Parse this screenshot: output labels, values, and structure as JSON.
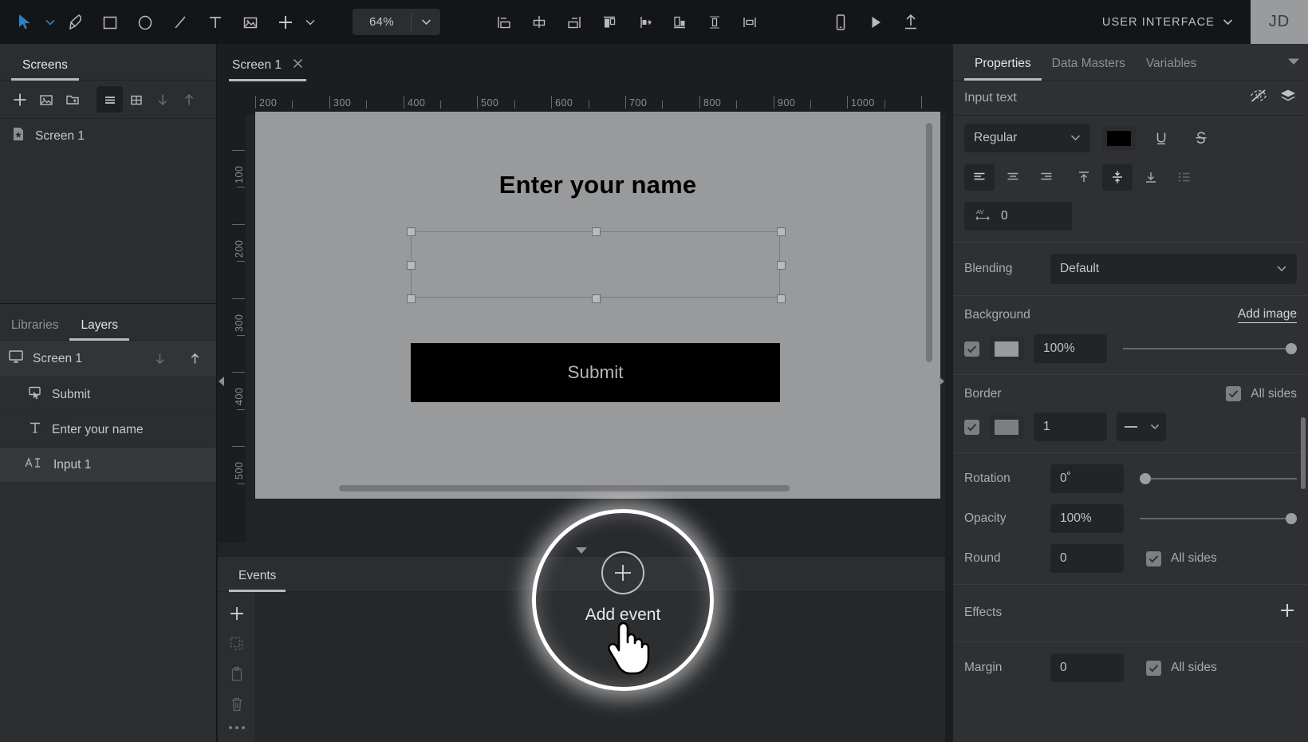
{
  "toolbar": {
    "tools": [
      {
        "name": "select-tool",
        "icon": "cursor-arrow-icon"
      },
      {
        "name": "pen-tool",
        "icon": "pen-icon"
      },
      {
        "name": "rectangle-tool",
        "icon": "rectangle-icon"
      },
      {
        "name": "ellipse-tool",
        "icon": "ellipse-icon"
      },
      {
        "name": "line-tool",
        "icon": "line-icon"
      },
      {
        "name": "text-tool",
        "icon": "text-t-icon"
      },
      {
        "name": "image-tool",
        "icon": "image-icon"
      },
      {
        "name": "add-tool",
        "icon": "plus-icon"
      }
    ],
    "zoom_value": "64%",
    "align_tools": [
      {
        "name": "align-left",
        "icon": "align-left-icon"
      },
      {
        "name": "align-center-horizontal",
        "icon": "align-center-h-icon"
      },
      {
        "name": "align-right",
        "icon": "align-right-icon"
      },
      {
        "name": "align-top",
        "icon": "align-top-icon"
      },
      {
        "name": "align-middle-vertical",
        "icon": "align-middle-v-icon"
      },
      {
        "name": "align-bottom",
        "icon": "align-bottom-icon"
      },
      {
        "name": "distribute-vertical",
        "icon": "distribute-v-icon"
      },
      {
        "name": "distribute-horizontal",
        "icon": "distribute-h-icon"
      }
    ],
    "right_tools": [
      {
        "name": "device-preview",
        "icon": "mobile-device-icon"
      },
      {
        "name": "play-preview",
        "icon": "play-icon"
      },
      {
        "name": "publish-upload",
        "icon": "upload-arrow-icon"
      }
    ],
    "project_label": "USER INTERFACE",
    "avatar_initials": "JD",
    "accent": "#2f7fc1"
  },
  "screens_panel": {
    "tab_label": "Screens",
    "actions": [
      {
        "name": "add-screen-button",
        "icon": "plus-icon"
      },
      {
        "name": "add-screen-image-button",
        "icon": "image-icon"
      },
      {
        "name": "add-folder-button",
        "icon": "folder-plus-icon"
      },
      {
        "name": "list-view-button",
        "icon": "list-view-icon"
      },
      {
        "name": "grid-view-button",
        "icon": "grid-view-icon"
      },
      {
        "name": "move-down-button",
        "icon": "arrow-down-icon"
      },
      {
        "name": "move-up-button",
        "icon": "arrow-up-icon"
      }
    ],
    "items": [
      {
        "label": "Screen 1",
        "icon": "screen-star-icon"
      }
    ]
  },
  "layers_panel": {
    "tabs": [
      {
        "label": "Libraries",
        "active": false
      },
      {
        "label": "Layers",
        "active": true
      }
    ],
    "root": {
      "label": "Screen 1",
      "icon": "monitor-icon"
    },
    "root_actions": [
      {
        "name": "layer-move-down-button",
        "icon": "arrow-down-icon"
      },
      {
        "name": "layer-move-up-button",
        "icon": "arrow-up-icon"
      }
    ],
    "items": [
      {
        "label": "Submit",
        "icon": "button-cursor-icon",
        "selected": false
      },
      {
        "label": "Enter your name",
        "icon": "text-t-icon",
        "selected": false
      },
      {
        "label": "Input 1",
        "icon": "input-ai-icon",
        "selected": true
      }
    ]
  },
  "canvas": {
    "tab_label": "Screen 1",
    "ruler_h_labels": [
      "200",
      "300",
      "400",
      "500",
      "600",
      "700",
      "800",
      "900",
      "1000"
    ],
    "ruler_v_labels": [
      "100",
      "200",
      "300",
      "400",
      "500"
    ],
    "artboard": {
      "title": "Enter your name",
      "submit_label": "Submit",
      "background": "#999a9b",
      "title_color": "#000000",
      "submit_bg": "#000000",
      "submit_color": "#b4b5b7"
    }
  },
  "events_panel": {
    "tab_label": "Events",
    "rail_actions": [
      {
        "name": "add-event-button",
        "icon": "plus-icon"
      },
      {
        "name": "duplicate-event-button",
        "icon": "duplicate-dashed-icon"
      },
      {
        "name": "paste-event-button",
        "icon": "clipboard-icon"
      },
      {
        "name": "delete-event-button",
        "icon": "trash-icon"
      },
      {
        "name": "more-options-button",
        "icon": "ellipsis-icon"
      }
    ]
  },
  "properties_panel": {
    "tabs": [
      {
        "label": "Properties",
        "active": true
      },
      {
        "label": "Data Masters",
        "active": false
      },
      {
        "label": "Variables",
        "active": false
      }
    ],
    "selection_name": "Input text",
    "header_actions": [
      {
        "name": "hide-element-button",
        "icon": "eye-hidden-icon"
      },
      {
        "name": "layers-stack-button",
        "icon": "layers-stack-icon"
      }
    ],
    "typography": {
      "weight_value": "Regular",
      "color_swatch": "#000000",
      "underline_label": "U",
      "strikethrough_label": "S",
      "align_buttons": [
        {
          "name": "text-align-left-button",
          "icon": "align-text-left-icon",
          "active": true
        },
        {
          "name": "text-align-center-button",
          "icon": "align-text-center-icon",
          "active": false
        },
        {
          "name": "text-align-right-button",
          "icon": "align-text-right-icon",
          "active": false
        },
        {
          "name": "text-valign-top-button",
          "icon": "valign-top-icon",
          "active": false
        },
        {
          "name": "text-valign-middle-button",
          "icon": "valign-middle-icon",
          "active": true
        },
        {
          "name": "text-valign-bottom-button",
          "icon": "valign-bottom-icon",
          "active": false
        },
        {
          "name": "text-list-button",
          "icon": "bullet-list-icon",
          "active": false
        }
      ],
      "letter_spacing_value": "0",
      "letter_spacing_icon": "letter-spacing-icon"
    },
    "blending": {
      "label": "Blending",
      "value": "Default"
    },
    "background": {
      "label": "Background",
      "add_image_label": "Add image",
      "enabled": true,
      "swatch": "#9a9b9d",
      "opacity_value": "100%",
      "slider_pct": 100
    },
    "border": {
      "label": "Border",
      "all_sides_label": "All sides",
      "all_sides_checked": true,
      "enabled": true,
      "swatch": "#7d7f81",
      "width_value": "1",
      "style_icon": "solid-line-icon"
    },
    "rotation": {
      "label": "Rotation",
      "value": "0˚",
      "slider_pct": 0
    },
    "opacity": {
      "label": "Opacity",
      "value": "100%",
      "slider_pct": 100
    },
    "round": {
      "label": "Round",
      "value": "0",
      "all_sides_label": "All sides",
      "all_sides_checked": true
    },
    "effects": {
      "label": "Effects",
      "add_icon": "plus-icon"
    },
    "margin": {
      "label": "Margin",
      "value": "0",
      "all_sides_label": "All sides",
      "all_sides_checked": true
    }
  },
  "spotlight": {
    "label": "Add event",
    "plus_icon": "plus-circle-icon",
    "cursor_icon": "hand-pointer-cursor"
  }
}
